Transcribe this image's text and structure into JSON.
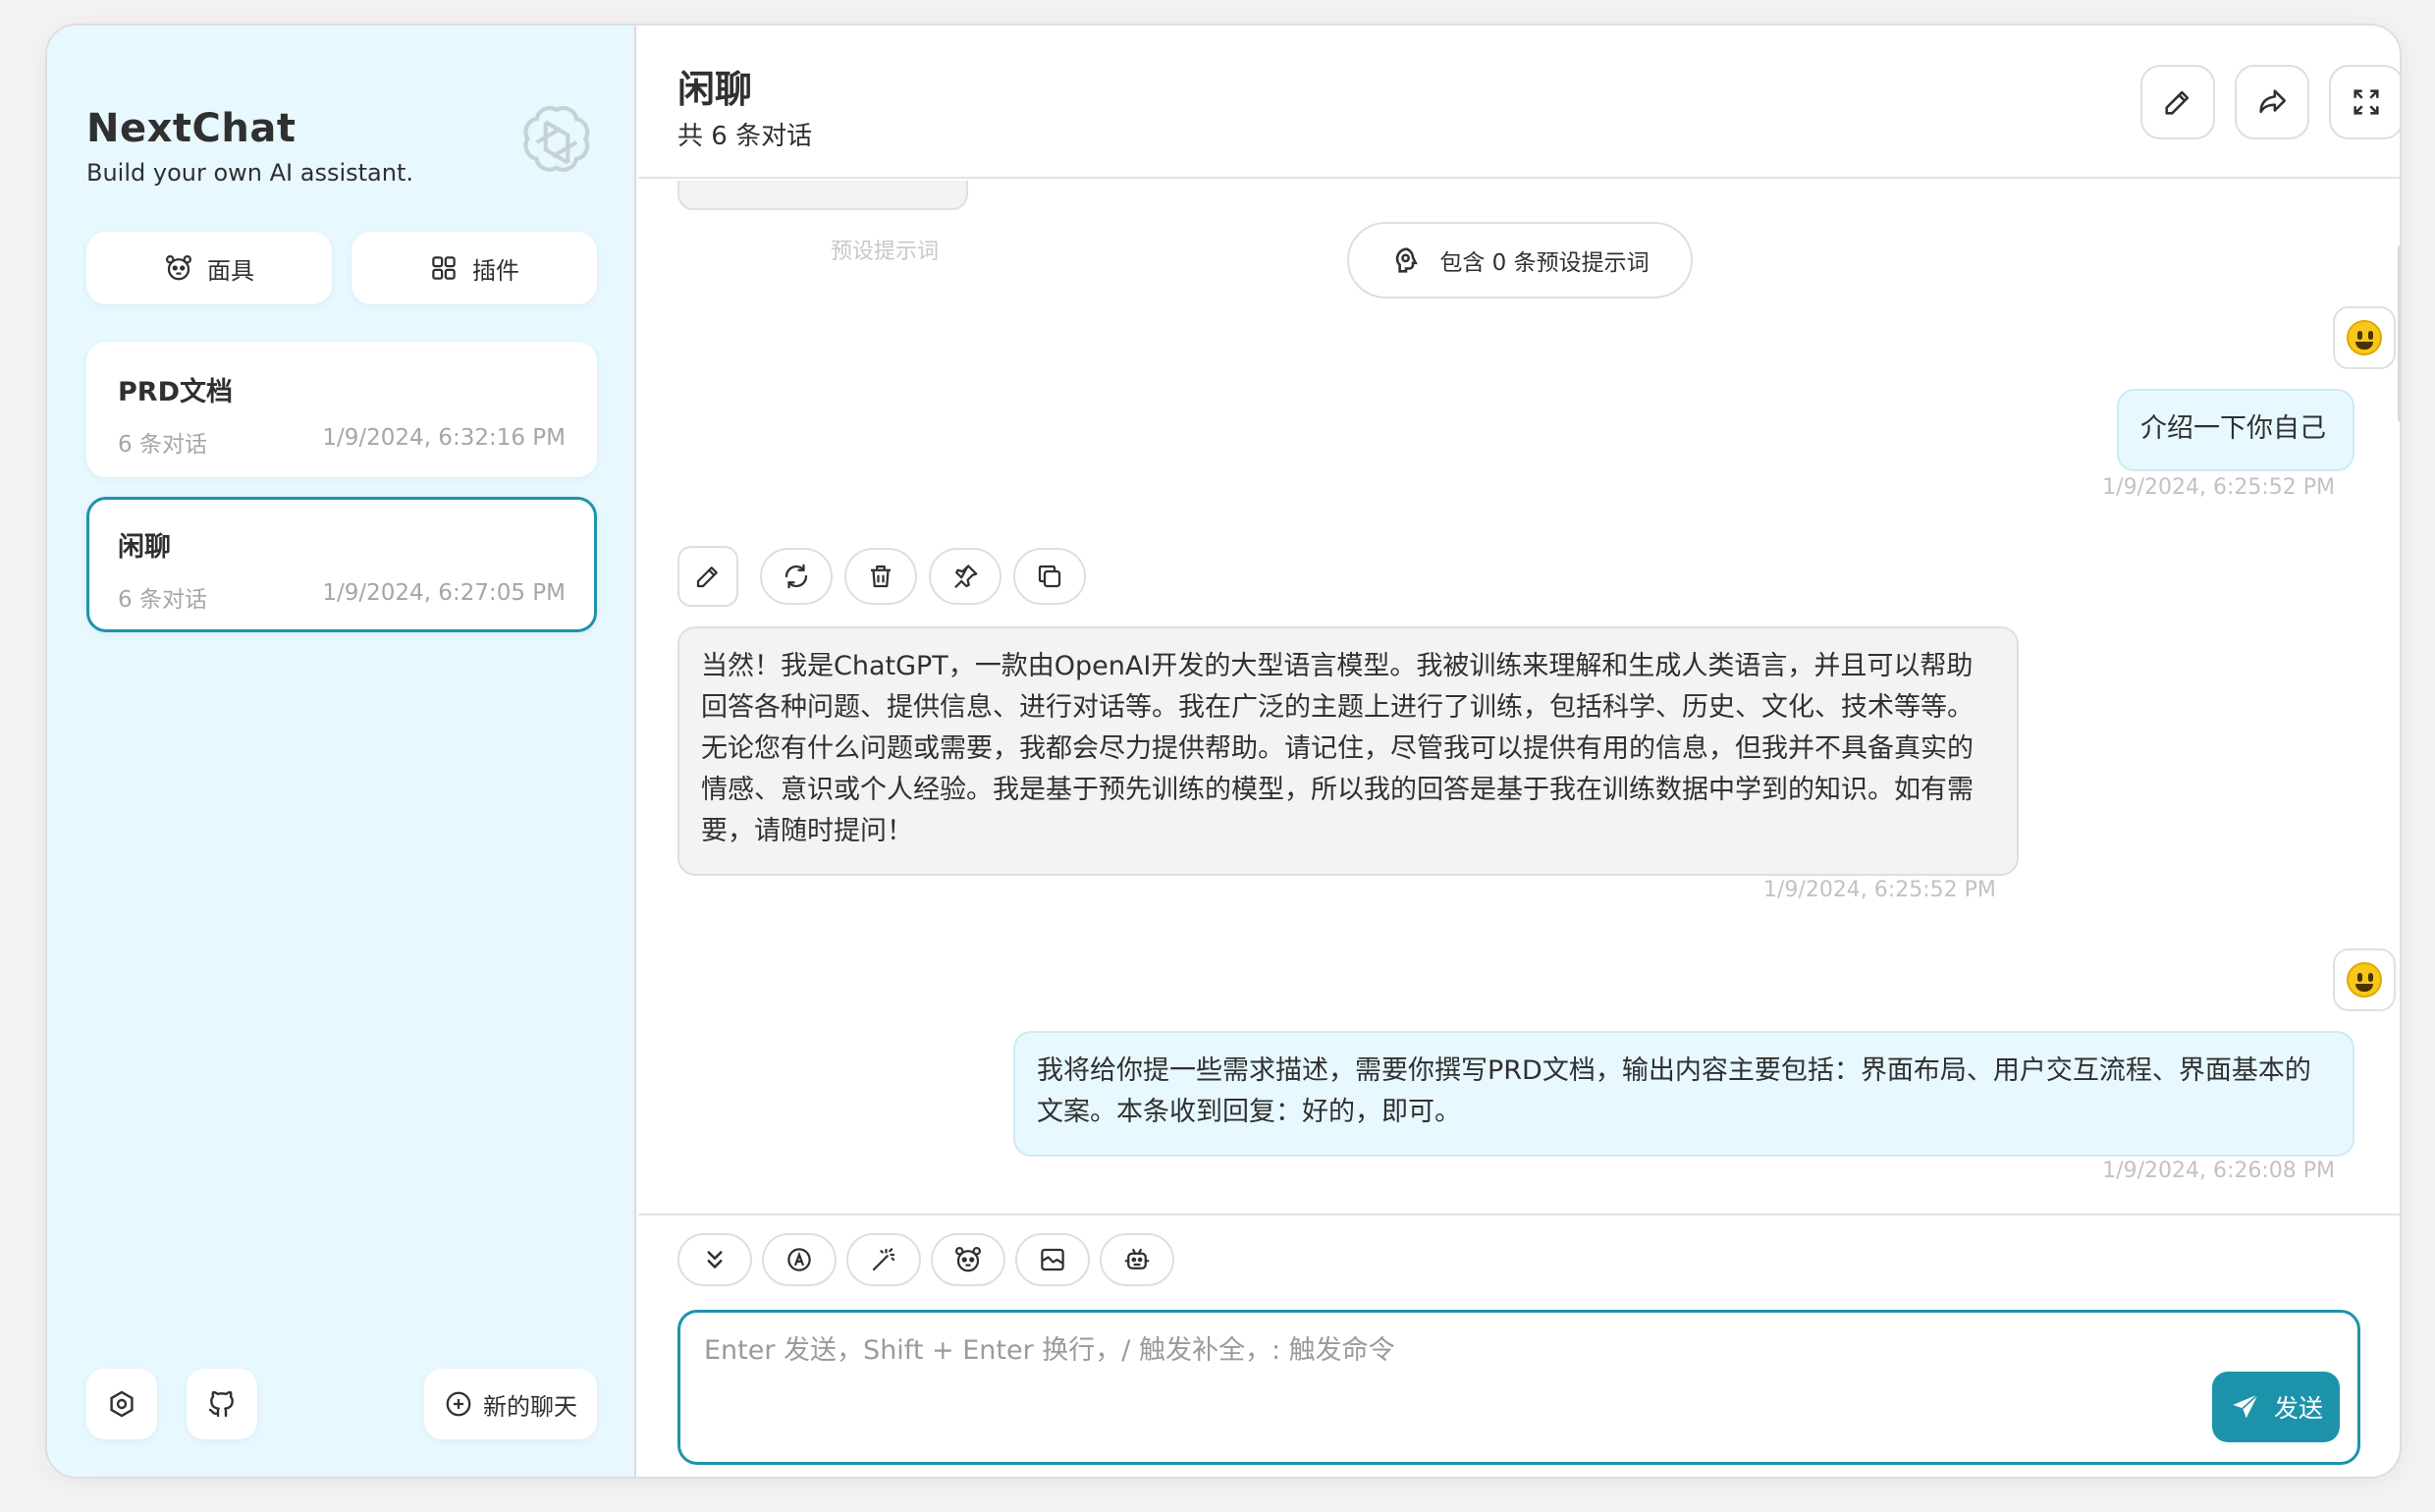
{
  "sidebar": {
    "title": "NextChat",
    "subtitle": "Build your own AI assistant.",
    "mask_button": "面具",
    "plugin_button": "插件",
    "chats": [
      {
        "title": "PRD文档",
        "count": "6 条对话",
        "date": "1/9/2024, 6:32:16 PM",
        "active": false
      },
      {
        "title": "闲聊",
        "count": "6 条对话",
        "date": "1/9/2024, 6:27:05 PM",
        "active": true
      }
    ],
    "new_chat": "新的聊天"
  },
  "header": {
    "title": "闲聊",
    "subtitle": "共 6 条对话"
  },
  "messages": {
    "preset_label": "预设提示词",
    "context_pill": "包含 0 条预设提示词",
    "items": [
      {
        "role": "user",
        "text": "介绍一下你自己",
        "date": "1/9/2024, 6:25:52 PM"
      },
      {
        "role": "assistant",
        "text": "当然！我是ChatGPT，一款由OpenAI开发的大型语言模型。我被训练来理解和生成人类语言，并且可以帮助回答各种问题、提供信息、进行对话等。我在广泛的主题上进行了训练，包括科学、历史、文化、技术等等。无论您有什么问题或需要，我都会尽力提供帮助。请记住，尽管我可以提供有用的信息，但我并不具备真实的情感、意识或个人经验。我是基于预先训练的模型，所以我的回答是基于我在训练数据中学到的知识。如有需要，请随时提问！",
        "date": "1/9/2024, 6:25:52 PM"
      },
      {
        "role": "user",
        "text": "我将给你提一些需求描述，需要你撰写PRD文档，输出内容主要包括：界面布局、用户交互流程、界面基本的文案。本条收到回复：好的，即可。",
        "date": "1/9/2024, 6:26:08 PM"
      }
    ]
  },
  "input": {
    "placeholder": "Enter 发送，Shift + Enter 换行，/ 触发补全，: 触发命令",
    "send": "发送"
  },
  "colors": {
    "accent": "#1d93ab",
    "sidebar_bg": "#e7f8ff",
    "user_bubble": "#e7f8ff",
    "bot_bubble": "#f3f3f3"
  }
}
